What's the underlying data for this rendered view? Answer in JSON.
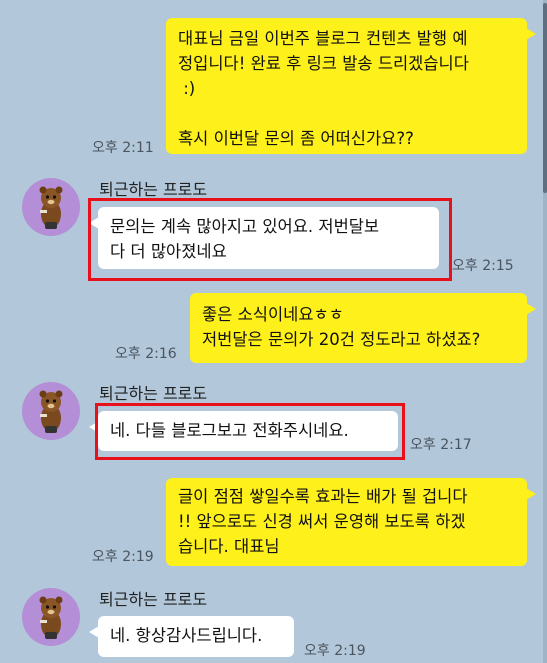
{
  "messages": [
    {
      "sender_type": "me",
      "text": "대표님 금일 이번주 블로그 컨텐츠 발행 예\n정입니다! 완료 후 링크 발송 드리겠습니다\n :)\n\n혹시 이번달 문의 좀 어떠신가요??",
      "time": "오후 2:11"
    },
    {
      "sender_type": "them",
      "sender": "퇴근하는 프로도",
      "text": "문의는 계속 많아지고 있어요. 저번달보\n다 더 많아졌네요",
      "time": "오후 2:15",
      "highlighted": true
    },
    {
      "sender_type": "me",
      "text": "좋은 소식이네요ㅎㅎ\n저번달은 문의가 20건 정도라고 하셨죠?",
      "time": "오후 2:16"
    },
    {
      "sender_type": "them",
      "sender": "퇴근하는 프로도",
      "text": "네. 다들 블로그보고 전화주시네요.",
      "time": "오후 2:17",
      "highlighted": true
    },
    {
      "sender_type": "me",
      "text": "글이 점점 쌓일수록 효과는 배가 될 겁니다\n!! 앞으로도 신경 써서 운영해 보도록 하겠\n습니다. 대표님",
      "time": "오후 2:19"
    },
    {
      "sender_type": "them",
      "sender": "퇴근하는 프로도",
      "text": "네. 항상감사드립니다.",
      "time": "오후 2:19"
    }
  ],
  "highlight_color": "#e8101a",
  "my_bubble_color": "#fef01b",
  "their_bubble_color": "#ffffff",
  "background_color": "#b2c7d9"
}
